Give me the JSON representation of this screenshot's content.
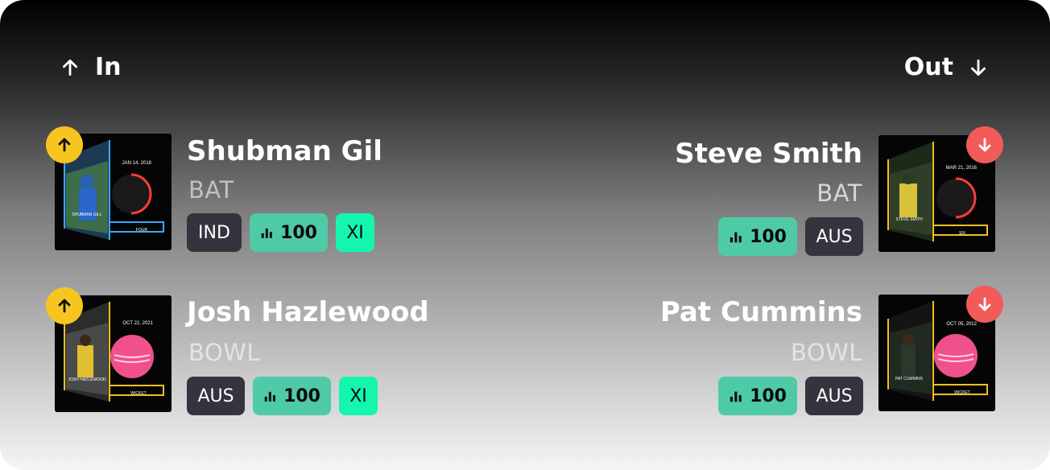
{
  "header": {
    "in_label": "In",
    "out_label": "Out"
  },
  "players_in": [
    {
      "name": "Shubman Gil",
      "role": "BAT",
      "team": "IND",
      "score": "100",
      "xi": "XI",
      "card": {
        "date": "JAN 14, 2018",
        "caption": "FOUR",
        "player_text": "SHUBMAN GILL"
      }
    },
    {
      "name": "Josh Hazlewood",
      "role": "BOWL",
      "team": "AUS",
      "score": "100",
      "xi": "XI",
      "card": {
        "date": "OCT 22, 2021",
        "caption": "WICKET",
        "player_text": "JOSH HAZLEWOOD"
      }
    }
  ],
  "players_out": [
    {
      "name": "Steve Smith",
      "role": "BAT",
      "team": "AUS",
      "score": "100",
      "card": {
        "date": "MAR 21, 2016",
        "caption": "SIX",
        "player_text": "STEVE SMITH"
      }
    },
    {
      "name": "Pat Cummins",
      "role": "BOWL",
      "team": "AUS",
      "score": "100",
      "card": {
        "date": "OCT 05, 2012",
        "caption": "WICKET",
        "player_text": "PAT CUMMINS"
      }
    }
  ],
  "colors": {
    "in_badge": "#f7c51f",
    "out_badge": "#f35a5a",
    "score_chip": "#4fcaa6",
    "xi_chip": "#14f5ae",
    "team_chip": "#33343d"
  },
  "icons": {
    "in": "arrow-up-icon",
    "out": "arrow-down-icon",
    "score": "bar-chart-icon"
  }
}
